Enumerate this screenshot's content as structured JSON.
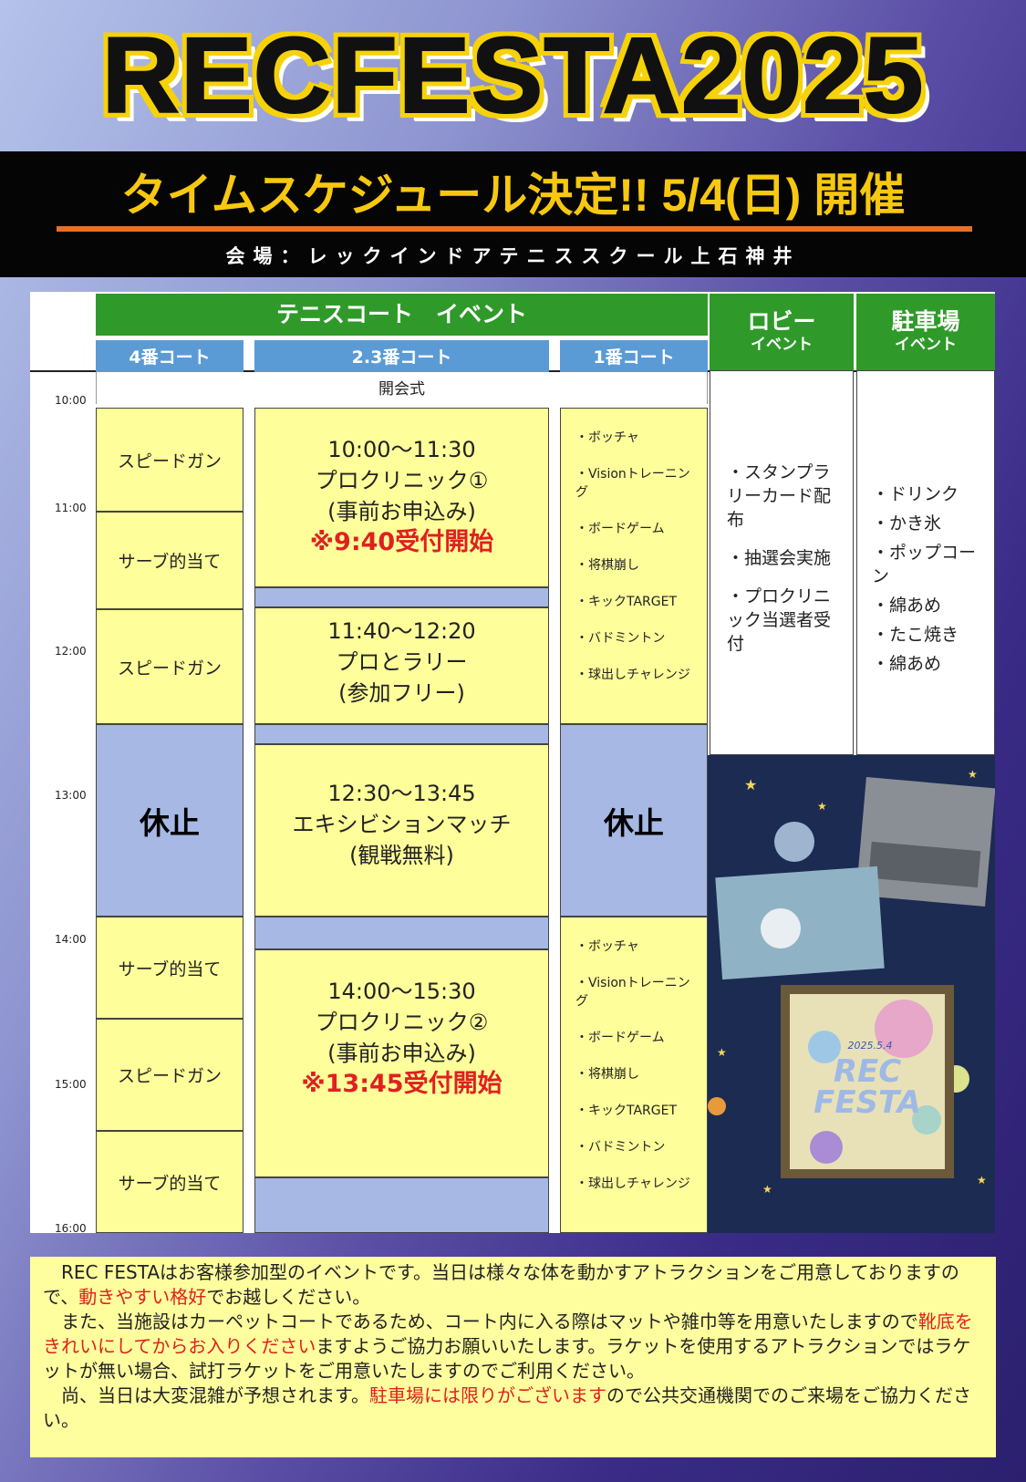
{
  "header": {
    "title": "RECFESTA2025",
    "subtitle": "タイムスケジュール決定!!  5/4(日) 開催",
    "venue": "会場：レックインドアテニススクール上石神井"
  },
  "schedule": {
    "times": [
      "10:00",
      "11:00",
      "12:00",
      "13:00",
      "14:00",
      "15:00",
      "16:00"
    ],
    "group_header": "テニスコート　イベント",
    "court_headers": [
      "4番コート",
      "2.3番コート",
      "1番コート"
    ],
    "lobby_header": {
      "main": "ロビー",
      "sub": "イベント"
    },
    "parking_header": {
      "main": "駐車場",
      "sub": "イベント"
    },
    "opening": "開会式",
    "court4": [
      "スピードガン",
      "サーブ的当て",
      "スピードガン",
      "休止",
      "サーブ的当て",
      "スピードガン",
      "サーブ的当て"
    ],
    "court23": [
      {
        "time": "10:00〜11:30",
        "name": "プロクリニック①",
        "note": "(事前お申込み)",
        "red": "※9:40受付開始"
      },
      {
        "time": "11:40〜12:20",
        "name": "プロとラリー",
        "note": "(参加フリー)"
      },
      {
        "time": "12:30〜13:45",
        "name": "エキシビションマッチ",
        "note": "(観戦無料)"
      },
      {
        "time": "14:00〜15:30",
        "name": "プロクリニック②",
        "note": "(事前お申込み)",
        "red": "※13:45受付開始"
      }
    ],
    "court1_am": [
      "・ボッチャ",
      "・Visionトレーニング",
      "・ボードゲーム",
      "・将棋崩し",
      "・キックTARGET",
      "・バドミントン",
      "・球出しチャレンジ"
    ],
    "court1_rest": "休止",
    "court1_pm": [
      "・ボッチャ",
      "・Visionトレーニング",
      "・ボードゲーム",
      "・将棋崩し",
      "・キックTARGET",
      "・バドミントン",
      "・球出しチャレンジ"
    ],
    "lobby": [
      "・スタンプラリーカード配布",
      "・抽選会実施",
      "・プロクリニック当選者受付"
    ],
    "parking": [
      "・ドリンク",
      "・かき氷",
      "・ポップコーン",
      "・綿あめ",
      "・たこ焼き",
      "・綿あめ"
    ],
    "poster_text": {
      "date": "2025.5.4",
      "line1": "REC",
      "line2": "FESTA"
    }
  },
  "notice": {
    "p1_a": "　REC FESTAはお客様参加型のイベントです。当日は様々な体を動かすアトラクションをご用意しておりますので、",
    "p1_red": "動きやすい格好",
    "p1_b": "でお越しください。",
    "p2_a": "　また、当施設はカーペットコートであるため、コート内に入る際はマットや雑巾等を用意いたしますので",
    "p2_red": "靴底をきれいにしてからお入りください",
    "p2_b": "ますようご協力お願いいたします。ラケットを使用するアトラクションではラケットが無い場合、試打ラケットをご用意いたしますのでご利用ください。",
    "p3_a": "　尚、当日は大変混雑が予想されます。",
    "p3_red": "駐車場には限りがございます",
    "p3_b": "ので公共交通機関でのご来場をご協力ください。"
  }
}
